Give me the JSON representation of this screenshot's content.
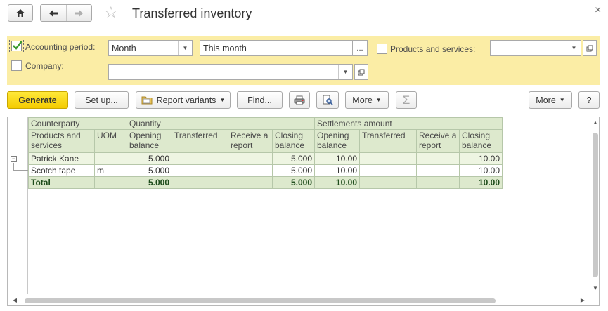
{
  "window": {
    "title": "Transferred inventory"
  },
  "filters": {
    "accounting_period_label": "Accounting period:",
    "period_type": "Month",
    "period_value": "This month",
    "dots": "...",
    "company_label": "Company:",
    "company_value": "",
    "products_label": "Products and services:",
    "products_value": "",
    "accounting_period_checked": true,
    "company_checked": false,
    "products_checked": false
  },
  "toolbar": {
    "generate": "Generate",
    "setup": "Set up...",
    "report_variants": "Report variants",
    "find": "Find...",
    "more": "More",
    "more_right": "More",
    "help": "?"
  },
  "report": {
    "header_row1": {
      "counterparty": "Counterparty",
      "quantity": "Quantity",
      "settlements": "Settlements amount"
    },
    "header_row2": {
      "products": "Products and services",
      "uom": "UOM",
      "q_opening": "Opening balance",
      "q_transferred": "Transferred",
      "q_receive": "Receive a report",
      "q_closing": "Closing balance",
      "s_opening": "Opening balance",
      "s_transferred": "Transferred",
      "s_receive": "Receive a report",
      "s_closing": "Closing balance"
    },
    "group_row": {
      "name": "Patrick Kane",
      "uom": "",
      "q_opening": "5.000",
      "q_transferred": "",
      "q_receive": "",
      "q_closing": "5.000",
      "s_opening": "10.00",
      "s_transferred": "",
      "s_receive": "",
      "s_closing": "10.00"
    },
    "detail_row": {
      "name": "Scotch tape",
      "uom": "m",
      "q_opening": "5.000",
      "q_transferred": "",
      "q_receive": "",
      "q_closing": "5.000",
      "s_opening": "10.00",
      "s_transferred": "",
      "s_receive": "",
      "s_closing": "10.00"
    },
    "total_row": {
      "name": "Total",
      "uom": "",
      "q_opening": "5.000",
      "q_transferred": "",
      "q_receive": "",
      "q_closing": "5.000",
      "s_opening": "10.00",
      "s_transferred": "",
      "s_receive": "",
      "s_closing": "10.00"
    }
  },
  "icons": {
    "home": "home-icon",
    "back": "arrow-left-icon",
    "forward": "arrow-right-icon",
    "star": "star-icon",
    "close": "close-icon",
    "print": "printer-icon",
    "preview": "print-preview-icon",
    "sum": "sigma-icon",
    "report_variants": "folder-icon"
  },
  "colors": {
    "filter_bg": "#fbeda5",
    "header_bg": "#dde9cd",
    "group_bg": "#eef5e2",
    "generate_bg": "#f4cb00"
  }
}
